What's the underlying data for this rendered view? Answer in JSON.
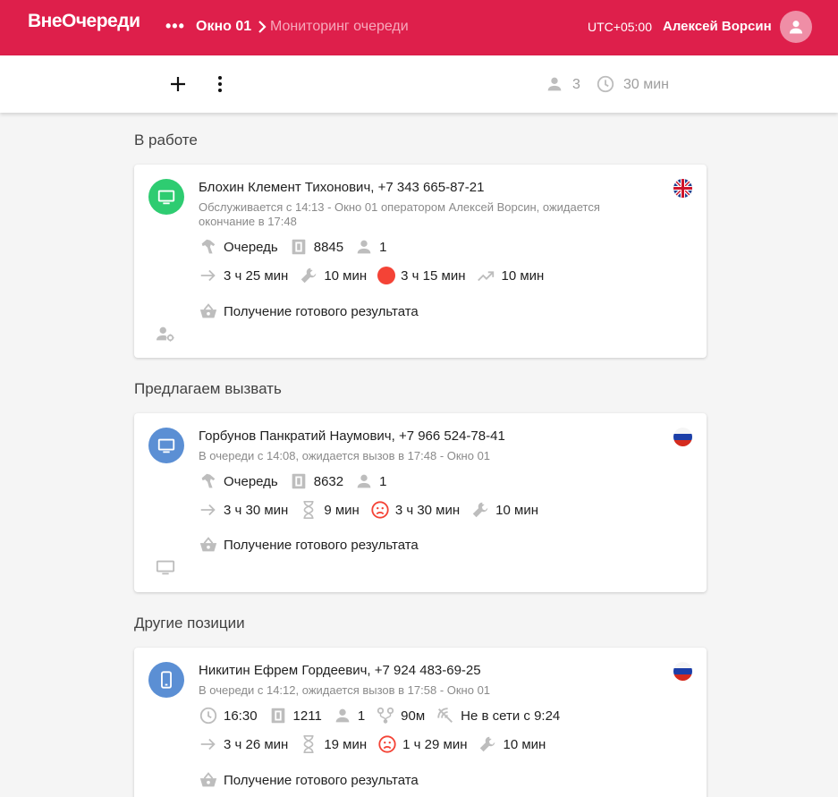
{
  "header": {
    "brand": "ВнеОчереди",
    "more": "•••",
    "breadcrumb_window": "Окно 01",
    "breadcrumb_page": "Мониторинг очереди",
    "timezone": "UTC+05:00",
    "user_name": "Алексей Ворсин"
  },
  "toolbar": {
    "people_count": "3",
    "wait_time": "30 мин"
  },
  "sections": {
    "working": "В работе",
    "suggest": "Предлагаем вызвать",
    "other": "Другие позиции"
  },
  "cards": [
    {
      "name": "Блохин Клемент Тихонович, +7 343 665-87-21",
      "sub": "Обслуживается с 14:13 - Окно 01 оператором Алексей Ворсин, ожидается окончание в 17:48",
      "queue_label": "Очередь",
      "ticket": "8845",
      "persons": "1",
      "duration": "3 ч 25 мин",
      "service_time": "10 мин",
      "status_time": "3 ч 15 мин",
      "trend_time": "10 мин",
      "service": "Получение готового результата",
      "flag": "uk",
      "status_color": "#f44336"
    },
    {
      "name": "Горбунов Панкратий Наумович, +7 966 524-78-41",
      "sub": "В очереди с 14:08, ожидается вызов в 17:48 - Окно 01",
      "queue_label": "Очередь",
      "ticket": "8632",
      "persons": "1",
      "duration": "3 ч 30 мин",
      "wait_time": "9 мин",
      "sad_time": "3 ч 30 мин",
      "service_time": "10 мин",
      "service": "Получение готового результата",
      "flag": "ru"
    },
    {
      "name": "Никитин Ефрем Гордеевич, +7 924 483-69-25",
      "sub": "В очереди с 14:12, ожидается вызов в 17:58 - Окно 01",
      "time": "16:30",
      "ticket": "1211",
      "persons": "1",
      "distance": "90м",
      "offline": "Не в сети с 9:24",
      "duration": "3 ч 26 мин",
      "wait_time": "19 мин",
      "sad_time": "1 ч 29 мин",
      "service_time": "10 мин",
      "service": "Получение готового результата",
      "flag": "ru"
    }
  ],
  "colors": {
    "brand": "#de1f4b",
    "green": "#2ecc71",
    "blue": "#5b8fd4",
    "icon_gray": "#9e9e9e",
    "red": "#f44336"
  }
}
